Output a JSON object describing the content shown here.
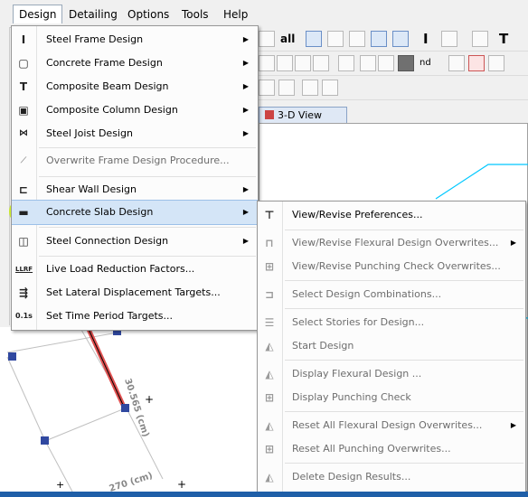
{
  "menubar": {
    "items": [
      "Design",
      "Detailing",
      "Options",
      "Tools",
      "Help"
    ]
  },
  "toolbar": {
    "all_label": "all",
    "nd_label": "nd"
  },
  "view_tab": {
    "label": "3-D View"
  },
  "design_menu": {
    "items": [
      {
        "label": "Steel Frame Design",
        "icon": "steel-frame-icon",
        "submenu": true
      },
      {
        "label": "Concrete Frame Design",
        "icon": "concrete-frame-icon",
        "submenu": true
      },
      {
        "label": "Composite Beam Design",
        "icon": "composite-beam-icon",
        "submenu": true
      },
      {
        "label": "Composite Column Design",
        "icon": "composite-column-icon",
        "submenu": true
      },
      {
        "label": "Steel Joist Design",
        "icon": "steel-joist-icon",
        "submenu": true
      },
      {
        "label": "Overwrite Frame Design Procedure...",
        "icon": "overwrite-frame-icon",
        "submenu": false,
        "disabled": true
      },
      {
        "label": "Shear Wall Design",
        "icon": "shear-wall-icon",
        "submenu": true
      },
      {
        "label": "Concrete Slab Design",
        "icon": "concrete-slab-icon",
        "submenu": true,
        "selected": true
      },
      {
        "label": "Steel Connection Design",
        "icon": "steel-connection-icon",
        "submenu": true
      },
      {
        "label": "Live Load Reduction Factors...",
        "icon": "llrf-icon",
        "submenu": false
      },
      {
        "label": "Set Lateral Displacement Targets...",
        "icon": "lateral-displacement-icon",
        "submenu": false
      },
      {
        "label": "Set Time Period Targets...",
        "icon": "time-period-icon",
        "submenu": false
      }
    ]
  },
  "icon_text": {
    "llrf": "LLRF",
    "time_period": "0.1s"
  },
  "slab_submenu": {
    "items": [
      {
        "label": "View/Revise Preferences...",
        "icon": "preferences-icon",
        "submenu": false,
        "disabled": false
      },
      {
        "label": "View/Revise Flexural Design Overwrites...",
        "icon": "flexural-overwrites-icon",
        "submenu": true,
        "disabled": true
      },
      {
        "label": "View/Revise Punching Check Overwrites...",
        "icon": "punching-overwrites-icon",
        "submenu": false,
        "disabled": true
      },
      {
        "label": "Select Design Combinations...",
        "icon": "design-combinations-icon",
        "submenu": false,
        "disabled": true
      },
      {
        "label": "Select Stories for Design...",
        "icon": "select-stories-icon",
        "submenu": false,
        "disabled": true
      },
      {
        "label": "Start Design",
        "icon": "start-design-icon",
        "submenu": false,
        "disabled": true
      },
      {
        "label": "Display Flexural Design ...",
        "icon": "display-flexural-icon",
        "submenu": false,
        "disabled": true
      },
      {
        "label": "Display Punching Check",
        "icon": "display-punching-icon",
        "submenu": false,
        "disabled": true
      },
      {
        "label": "Reset All Flexural Design Overwrites...",
        "icon": "reset-flexural-icon",
        "submenu": true,
        "disabled": true
      },
      {
        "label": "Reset All Punching Overwrites...",
        "icon": "reset-punching-icon",
        "submenu": false,
        "disabled": true
      },
      {
        "label": "Delete Design Results...",
        "icon": "delete-results-icon",
        "submenu": false,
        "disabled": true
      }
    ]
  },
  "canvas_labels": {
    "dim_a": "30.565 (cm)",
    "dim_b": "270 (cm)"
  },
  "colors": {
    "highlight": "#c8f000",
    "selected_bg": "#d4e5f7",
    "canvas_line": "#00c8ff",
    "node": "#3048a0",
    "member": "#e05050"
  }
}
